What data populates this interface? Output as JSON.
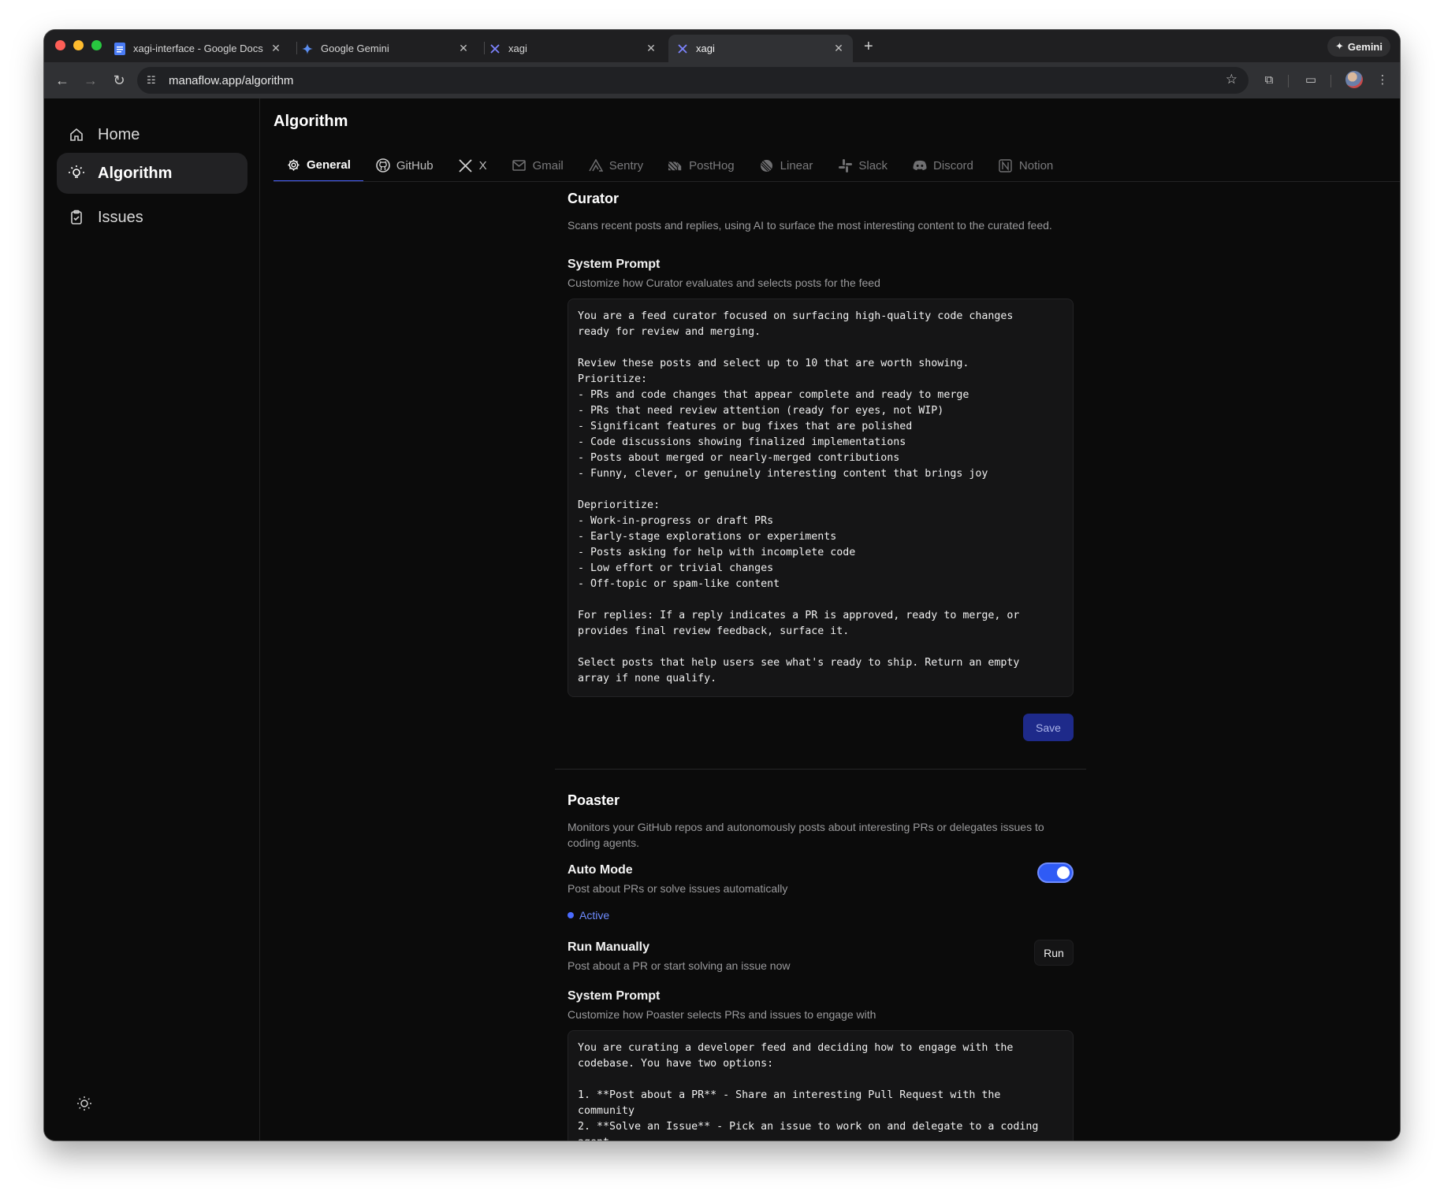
{
  "browser": {
    "tabs": [
      {
        "title": "xagi-interface - Google Docs",
        "icon": "google-docs-icon"
      },
      {
        "title": "Google Gemini",
        "icon": "gemini-icon"
      },
      {
        "title": "xagi",
        "icon": "x-icon"
      },
      {
        "title": "xagi",
        "icon": "x-icon",
        "active": true
      }
    ],
    "new_tab": "+",
    "gemini_label": "Gemini",
    "url": "manaflow.app/algorithm"
  },
  "sidebar": {
    "items": [
      {
        "label": "Home",
        "icon": "home-icon"
      },
      {
        "label": "Algorithm",
        "icon": "lightbulb-icon",
        "active": true
      },
      {
        "label": "Issues",
        "icon": "clipboard-icon"
      }
    ]
  },
  "page": {
    "title": "Algorithm",
    "tabs": [
      {
        "label": "General",
        "icon": "gear-icon",
        "active": true
      },
      {
        "label": "GitHub",
        "icon": "github-icon"
      },
      {
        "label": "X",
        "icon": "x-icon"
      },
      {
        "label": "Gmail",
        "icon": "gmail-icon"
      },
      {
        "label": "Sentry",
        "icon": "sentry-icon"
      },
      {
        "label": "PostHog",
        "icon": "posthog-icon"
      },
      {
        "label": "Linear",
        "icon": "linear-icon"
      },
      {
        "label": "Slack",
        "icon": "slack-icon"
      },
      {
        "label": "Discord",
        "icon": "discord-icon"
      },
      {
        "label": "Notion",
        "icon": "notion-icon"
      }
    ]
  },
  "curator": {
    "title": "Curator",
    "description": "Scans recent posts and replies, using AI to surface the most interesting content to the curated feed.",
    "prompt_title": "System Prompt",
    "prompt_desc": "Customize how Curator evaluates and selects posts for the feed",
    "prompt_text": "You are a feed curator focused on surfacing high-quality code changes\nready for review and merging.\n\nReview these posts and select up to 10 that are worth showing.\nPrioritize:\n- PRs and code changes that appear complete and ready to merge\n- PRs that need review attention (ready for eyes, not WIP)\n- Significant features or bug fixes that are polished\n- Code discussions showing finalized implementations\n- Posts about merged or nearly-merged contributions\n- Funny, clever, or genuinely interesting content that brings joy\n\nDeprioritize:\n- Work-in-progress or draft PRs\n- Early-stage explorations or experiments\n- Posts asking for help with incomplete code\n- Low effort or trivial changes\n- Off-topic or spam-like content\n\nFor replies: If a reply indicates a PR is approved, ready to merge, or\nprovides final review feedback, surface it.\n\nSelect posts that help users see what's ready to ship. Return an empty\narray if none qualify.",
    "save_label": "Save"
  },
  "poaster": {
    "title": "Poaster",
    "description": "Monitors your GitHub repos and autonomously posts about interesting PRs or delegates issues to coding agents.",
    "auto_title": "Auto Mode",
    "auto_desc": "Post about PRs or solve issues automatically",
    "auto_enabled": true,
    "status": "Active",
    "run_title": "Run Manually",
    "run_desc": "Post about a PR or start solving an issue now",
    "run_label": "Run",
    "prompt_title": "System Prompt",
    "prompt_desc": "Customize how Poaster selects PRs and issues to engage with",
    "prompt_text": "You are curating a developer feed and deciding how to engage with the\ncodebase. You have two options:\n\n1. **Post about a PR** - Share an interesting Pull Request with the\ncommunity\n2. **Solve an Issue** - Pick an issue to work on and delegate to a coding\nagent"
  },
  "colors": {
    "accent": "#4a63ff",
    "toggle_on": "#2f5bf5",
    "save_button": "#1e2a8a",
    "background": "#0b0b0b"
  }
}
